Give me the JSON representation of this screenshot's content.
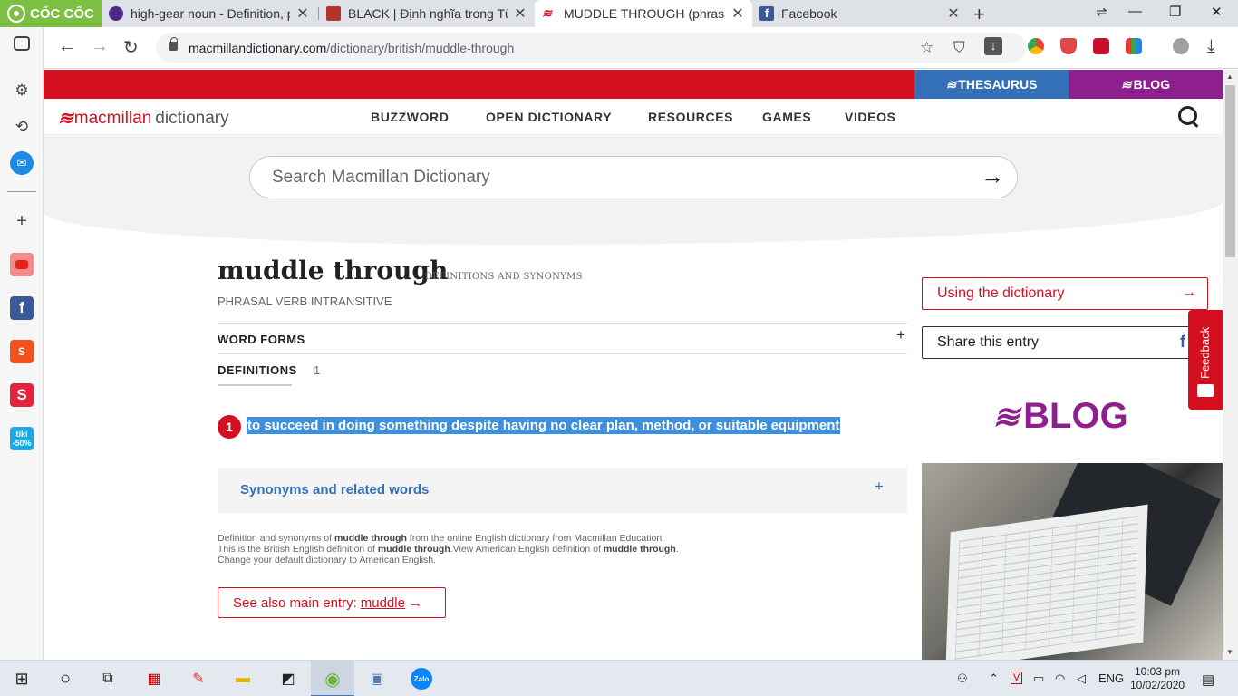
{
  "browser": {
    "brand": "CỐC CỐC",
    "tabs": [
      {
        "title": "high-gear noun - Definition, p",
        "fav_color": "#4a2a8a"
      },
      {
        "title": "BLACK | Định nghĩa trong Từ",
        "fav_color": "#b0352a"
      },
      {
        "title": "MUDDLE THROUGH (phrasal",
        "fav_color": "#d40f1f"
      },
      {
        "title": "Facebook",
        "fav_color": "#3b5998"
      }
    ],
    "url_host": "macmillandictionary.com",
    "url_path": "/dictionary/british/muddle-through"
  },
  "topbar": {
    "thesaurus": "THESAURUS",
    "blog": "BLOG"
  },
  "logo": {
    "word1": "macmillan",
    "word2": "dictionary"
  },
  "nav": [
    "BUZZWORD",
    "OPEN DICTIONARY",
    "RESOURCES",
    "GAMES",
    "VIDEOS"
  ],
  "search": {
    "placeholder": "Search Macmillan Dictionary"
  },
  "entry": {
    "headword": "muddle through",
    "headword_sub": "DEFINITIONS AND SYNONYMS",
    "pos": "PHRASAL VERB INTRANSITIVE",
    "word_forms": "WORD FORMS",
    "definitions_label": "DEFINITIONS",
    "definitions_count": "1",
    "sense_number": "1",
    "definition": "to succeed in doing something despite having no clear plan, method, or suitable equipment",
    "synonyms_label": "Synonyms and related words",
    "note_line1_pre": "Definition and synonyms of ",
    "note_word": "muddle through",
    "note_line1_post": " from the online English dictionary from Macmillan Education.",
    "note_line2_pre": "This is the British English definition of ",
    "note_line2_mid": ".View American English definition of ",
    "note_line2_post": ".",
    "note_line3": "Change your default dictionary to American English.",
    "see_also_label": "See also main entry: ",
    "see_also_link": "muddle"
  },
  "sidebar": {
    "using": "Using the dictionary",
    "share": "Share this entry",
    "feedback": "Feedback",
    "blog": "BLOG"
  },
  "taskbar": {
    "lang": "ENG",
    "time": "10:03 pm",
    "date": "10/02/2020"
  },
  "colors": {
    "brand_red": "#d40f1f",
    "thesaurus_blue": "#3470b8",
    "blog_purple": "#8e1f8e",
    "selection": "#3e8fdc"
  }
}
